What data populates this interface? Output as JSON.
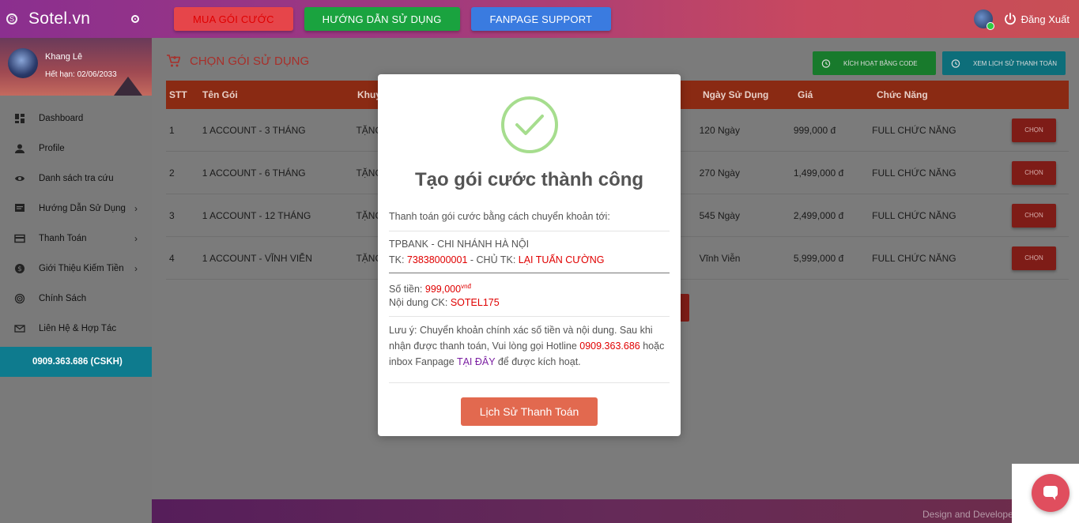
{
  "brand": {
    "name": "Sotel.vn"
  },
  "topnav": {
    "buttons": [
      "MUA GÓI CƯỚC",
      "HƯỚNG DẪN SỬ DỤNG",
      "FANPAGE SUPPORT"
    ],
    "logout_label": "Đăng Xuất"
  },
  "user": {
    "name": "Khang Lê",
    "expires": "Hết hạn: 02/06/2033"
  },
  "sidebar": {
    "items": [
      {
        "label": "Dashboard",
        "icon": "dashboard-icon"
      },
      {
        "label": "Profile",
        "icon": "person-icon"
      },
      {
        "label": "Danh sách tra cứu",
        "icon": "eye-icon"
      },
      {
        "label": "Hướng Dẫn Sử Dụng",
        "icon": "chat-icon",
        "has_children": true
      },
      {
        "label": "Thanh Toán",
        "icon": "card-icon",
        "has_children": true
      },
      {
        "label": "Giới Thiệu Kiếm Tiền",
        "icon": "dollar-icon",
        "has_children": true
      },
      {
        "label": "Chính Sách",
        "icon": "policy-icon"
      },
      {
        "label": "Liên Hệ & Hợp Tác",
        "icon": "mail-icon"
      }
    ],
    "hotline": "0909.363.686 (CSKH)"
  },
  "page": {
    "title": "CHỌN GÓI SỬ DỤNG",
    "activate_code_label": "KÍCH HOẠT BẰNG CODE",
    "payment_history_label": "XEM LỊCH SỬ THANH TOÁN"
  },
  "table": {
    "headers": {
      "stt": "STT",
      "name": "Tên Gói",
      "promo": "Khuy",
      "days": "Ngày Sử Dụng",
      "price": "Giá",
      "feature": "Chức Năng"
    },
    "rows": [
      {
        "stt": "1",
        "name": "1 ACCOUNT - 3 THÁNG",
        "promo": "TẶNG",
        "days": "120 Ngày",
        "price": "999,000 đ",
        "feature": "FULL CHỨC NĂNG",
        "action": "CHỌN"
      },
      {
        "stt": "2",
        "name": "1 ACCOUNT - 6 THÁNG",
        "promo": "TẶNG",
        "days": "270 Ngày",
        "price": "1,499,000 đ",
        "feature": "FULL CHỨC NĂNG",
        "action": "CHỌN"
      },
      {
        "stt": "3",
        "name": "1 ACCOUNT - 12 THÁNG",
        "promo": "TẶNG",
        "days": "545 Ngày",
        "price": "2,499,000 đ",
        "feature": "FULL CHỨC NĂNG",
        "action": "CHỌN"
      },
      {
        "stt": "4",
        "name": "1 ACCOUNT - VĨNH VIỄN",
        "promo": "TẶNG",
        "days": "Vĩnh Viễn",
        "price": "5,999,000 đ",
        "feature": "FULL CHỨC NĂNG",
        "action": "CHỌN"
      }
    ]
  },
  "footer": {
    "text": "Design and Developed"
  },
  "modal": {
    "title": "Tạo gói cước thành công",
    "intro": "Thanh toán gói cước bằng cách chuyển khoản tới:",
    "bank": "TPBANK - CHI NHÁNH HÀ NỘI",
    "account_prefix": "TK: ",
    "account_number": "73838000001",
    "owner_prefix": " - CHỦ TK: ",
    "owner": "LẠI TUẤN CƯỜNG",
    "amount_label": "Số tiền: ",
    "amount_value": "999,000",
    "amount_unit": "vnđ",
    "content_label": "Nội dung CK: ",
    "content_value": "SOTEL175",
    "note_1": "Lưu ý: Chuyển khoản chính xác số tiền và nội dung. Sau khi nhận được thanh toán, Vui lòng gọi Hotline ",
    "note_hotline": "0909.363.686",
    "note_2": " hoặc inbox Fanpage ",
    "note_link": "TẠI ĐÂY",
    "note_3": " để được kích hoạt.",
    "button": "Lịch Sử Thanh Toán"
  }
}
